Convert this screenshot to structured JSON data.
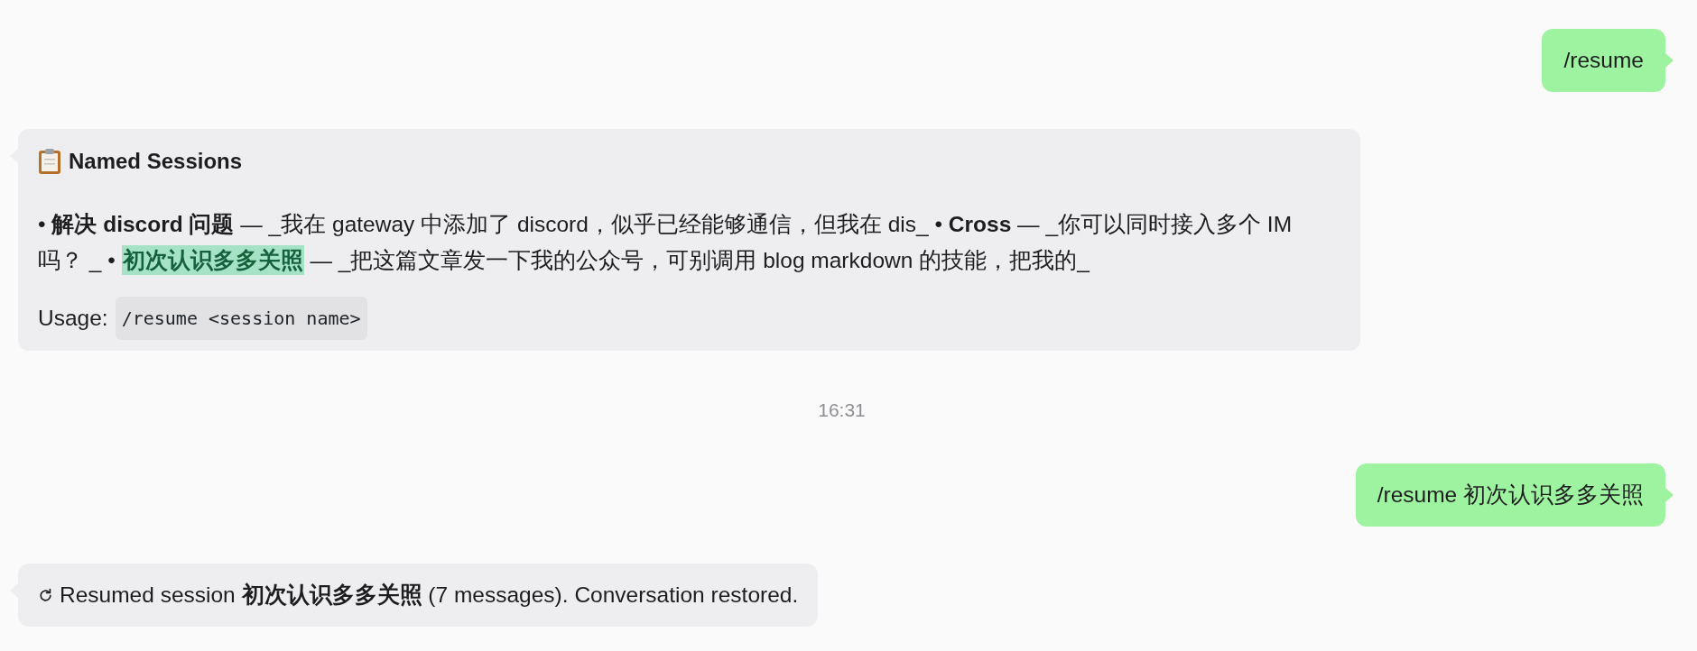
{
  "messages": [
    {
      "kind": "user",
      "text": "/resume"
    },
    {
      "kind": "sessions",
      "title": "Named Sessions",
      "sessions": [
        {
          "bullet": "•",
          "name": "解决 discord 问题",
          "separator": "—",
          "preview": "_我在 gateway 中添加了 discord，似乎已经能够通信，但我在 dis_",
          "highlighted": false
        },
        {
          "bullet": "•",
          "name": "Cross",
          "separator": "—",
          "preview": "_你可以同时接入多个 IM 吗？ _",
          "highlighted": false
        },
        {
          "bullet": "•",
          "name": "初次认识多多关照",
          "separator": "—",
          "preview": "_把这篇文章发一下我的公众号，可别调用 blog markdown 的技能，把我的_",
          "highlighted": true
        }
      ],
      "usage_label": "Usage:",
      "usage_command": "/resume <session name>"
    },
    {
      "kind": "time",
      "text": "16:31"
    },
    {
      "kind": "user",
      "text": "/resume 初次认识多多关照"
    },
    {
      "kind": "status",
      "text": "Resumed session **初次认识多多关照** (7 messages). Conversation restored."
    }
  ]
}
